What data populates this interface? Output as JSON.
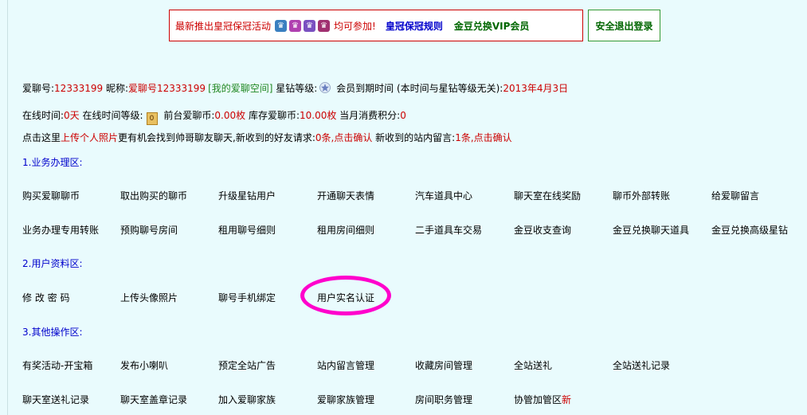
{
  "banner": {
    "text1": "最新推出皇冠保冠活动",
    "crown_icons": [
      "crown-1",
      "crown-2",
      "crown-3",
      "crown-4"
    ],
    "text2": "均可参加!",
    "link_rules": "皇冠保冠规则",
    "link_vip": "金豆兑换VIP会员"
  },
  "logout_label": "安全退出登录",
  "info": {
    "id_label": "爱聊号:",
    "id_value": "12333199",
    "nick_label": " 昵称:",
    "nick_value": "爱聊号12333199",
    "space_link": "[我的爱聊空间]",
    "star_label": " 星钻等级:",
    "expire_label": " 会员到期时间 (本时间与星钻等级无关):",
    "expire_value": "2013年4月3日"
  },
  "online": {
    "time_label": "在线时间:",
    "time_value": "0天",
    "level_label": " 在线时间等级:",
    "level_value": "0",
    "coin_label": " 前台爱聊币:",
    "coin_value": "0.00枚",
    "stock_label": " 库存爱聊币:",
    "stock_value": "10.00枚",
    "score_label": " 当月消费积分:",
    "score_value": "0"
  },
  "notice": {
    "t1": "点击这里",
    "upload_link": "上传个人照片",
    "t2": "更有机会找到帅哥聊友聊天,新收到的好友请求:",
    "friend_req": "0条,点击确认",
    "t3": " 新收到的站内留言:",
    "msg": "1条,点击确认"
  },
  "sections": [
    {
      "title": "1.业务办理区:",
      "rows": [
        [
          "购买爱聊聊币",
          "取出购买的聊币",
          "升级星钻用户",
          "开通聊天表情",
          "汽车道具中心",
          "聊天室在线奖励",
          "聊币外部转账",
          "给爱聊留言"
        ],
        [
          "业务办理专用转账",
          "预购聊号房间",
          "租用聊号细则",
          "租用房间细则",
          "二手道具车交易",
          "金豆收支查询",
          "金豆兑换聊天道具",
          "金豆兑换高级星钻"
        ]
      ]
    },
    {
      "title": "2.用户资料区:",
      "rows": [
        [
          "修 改 密 码",
          "上传头像照片",
          "聊号手机绑定",
          "用户实名认证"
        ]
      ]
    },
    {
      "title": "3.其他操作区:",
      "rows": [
        [
          "有奖活动-开宝箱",
          "发布小喇叭",
          "预定全站广告",
          "站内留言管理",
          "收藏房间管理",
          "全站送礼",
          "全站送礼记录"
        ],
        [
          "聊天室送礼记录",
          "聊天室盖章记录",
          "加入爱聊家族",
          "爱聊家族管理",
          "房间职务管理",
          "协管加管区"
        ]
      ]
    }
  ],
  "new_badge": "新"
}
